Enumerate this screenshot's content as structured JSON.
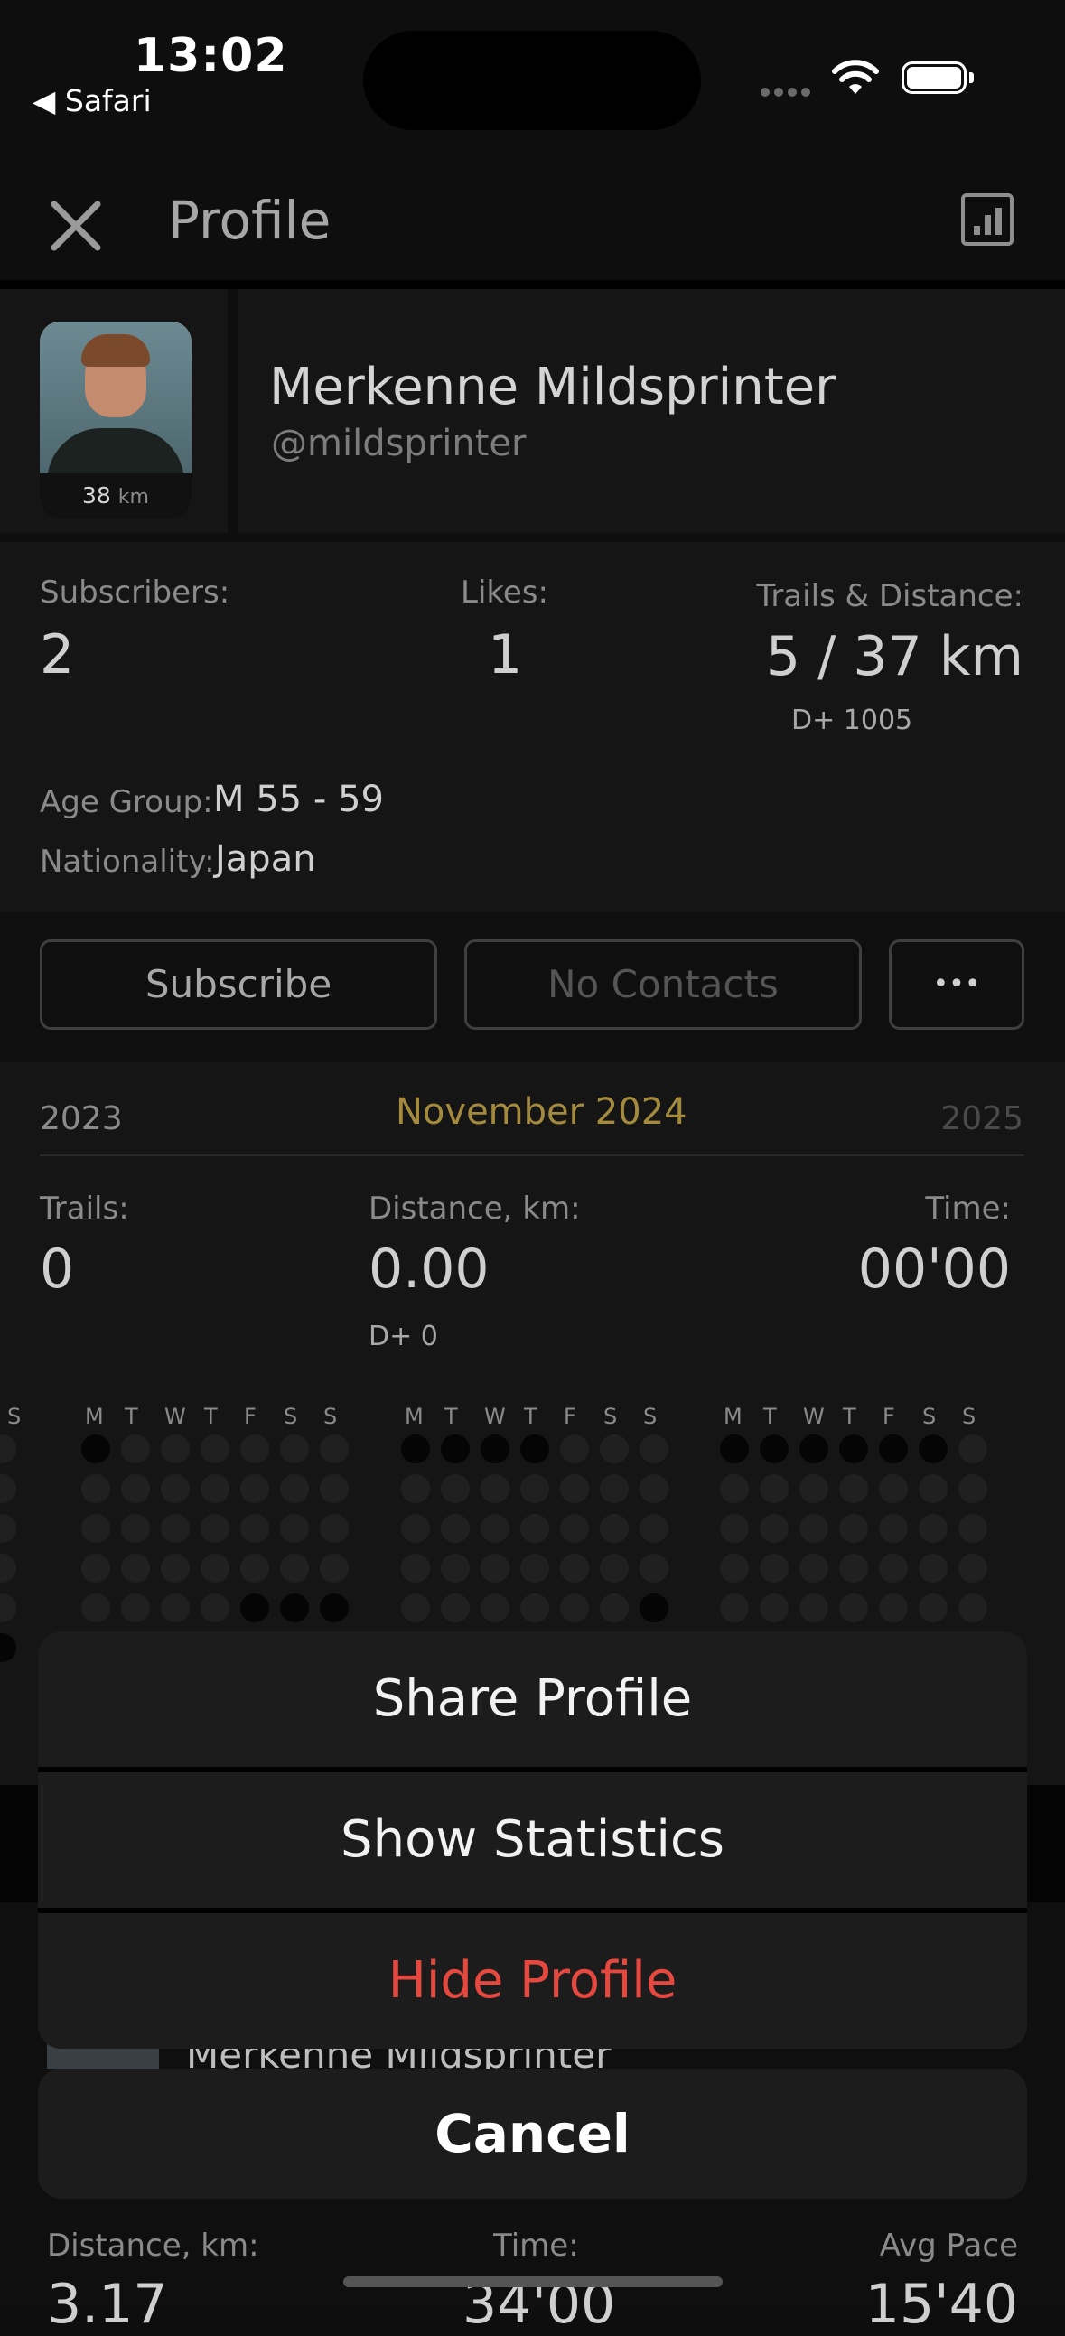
{
  "status_bar": {
    "time": "13:02",
    "back_app": "◀ Safari"
  },
  "header": {
    "title": "Profile"
  },
  "profile": {
    "name": "Merkenne Mildsprinter",
    "handle": "@mildsprinter",
    "avatar_km_value": "38",
    "avatar_km_unit": "km"
  },
  "stats": {
    "subscribers_label": "Subscribers:",
    "subscribers_value": "2",
    "likes_label": "Likes:",
    "likes_value": "1",
    "trails_label": "Trails & Distance:",
    "trails_value": "5 / 37 km",
    "trails_elev": "D+ 1005",
    "age_label": "Age Group:",
    "age_value": "M 55 - 59",
    "nationality_label": "Nationality:",
    "nationality_value": "Japan"
  },
  "actions": {
    "subscribe": "Subscribe",
    "contacts": "No Contacts",
    "more": "•••"
  },
  "month": {
    "prev_year": "2023",
    "current": "November 2024",
    "next_year": "2025",
    "trails_label": "Trails:",
    "trails_value": "0",
    "distance_label": "Distance, km:",
    "distance_value": "0.00",
    "distance_elev": "D+ 0",
    "time_label": "Time:",
    "time_value": "00'00",
    "weekday_labels": [
      "M",
      "T",
      "W",
      "T",
      "F",
      "S",
      "S"
    ],
    "edge_label": "S"
  },
  "peek": {
    "name": "Merkenne Mildsprinter",
    "distance_label": "Distance, km:",
    "time_label": "Time:",
    "pace_label": "Avg Pace",
    "distance_value": "3.17",
    "time_value": "34'00",
    "pace_value": "15'40"
  },
  "sheet": {
    "share": "Share Profile",
    "statistics": "Show Statistics",
    "hide": "Hide Profile",
    "cancel": "Cancel",
    "hide_color": "#e5483f"
  },
  "colors": {
    "accent_gold": "#a38a3c",
    "background": "#0e0e0e",
    "panel": "#151515"
  }
}
